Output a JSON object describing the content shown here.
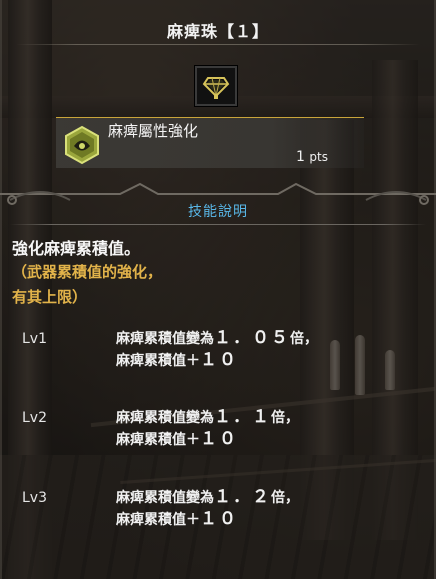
{
  "decoration": {
    "title": "麻痺珠【１】",
    "icon": "diamond-gem-icon",
    "accent_color": "#c9a53a"
  },
  "skill": {
    "icon": "paralysis-skill-hex-icon",
    "name": "麻痺屬性強化",
    "points_value": "1",
    "points_unit": "pts"
  },
  "description": {
    "header": "技能說明",
    "header_color": "#59b7e8",
    "main": "強化麻痺累積值。",
    "note_line1": "（武器累積值的強化，",
    "note_line2": "有其上限）",
    "note_color": "#e2b34a"
  },
  "levels": [
    {
      "label": "Lv1",
      "line1_prefix": "麻痺累積值變為",
      "line1_num": "１．０５",
      "line1_suffix": "倍，",
      "line2_prefix": "麻痺累積值＋",
      "line2_num": "１０"
    },
    {
      "label": "Lv2",
      "line1_prefix": "麻痺累積值變為",
      "line1_num": "１．１",
      "line1_suffix": "倍，",
      "line2_prefix": "麻痺累積值＋",
      "line2_num": "１０"
    },
    {
      "label": "Lv3",
      "line1_prefix": "麻痺累積值變為",
      "line1_num": "１．２",
      "line1_suffix": "倍，",
      "line2_prefix": "麻痺累積值＋",
      "line2_num": "１０"
    }
  ]
}
